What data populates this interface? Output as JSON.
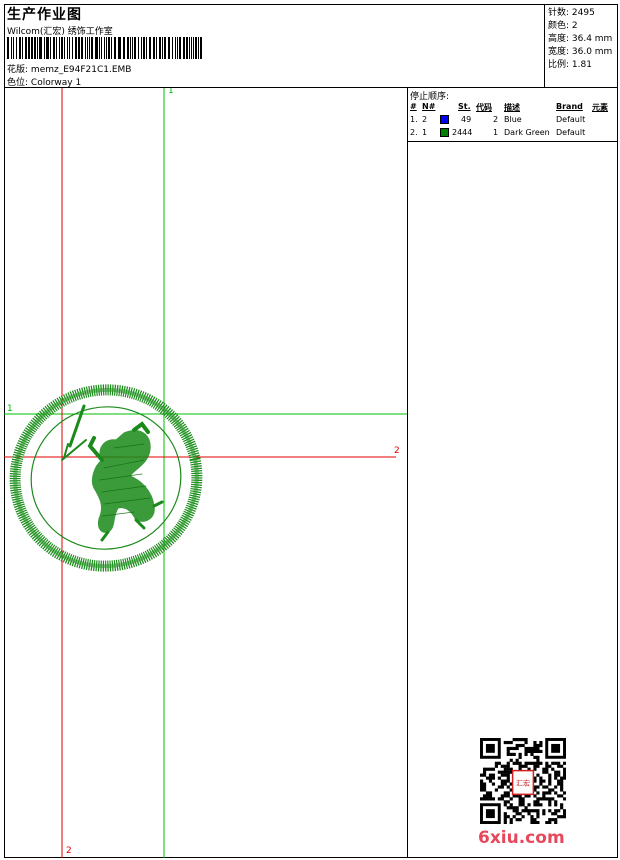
{
  "header": {
    "title": "生产作业图",
    "studio": "Wilcom(汇宏) 绣饰工作室",
    "design_label": "花版:",
    "design_value": "memz_E94F21C1.EMB",
    "colorway_label": "色位:",
    "colorway_value": "Colorway 1"
  },
  "stats": {
    "stitches": "针数: 2495",
    "colors": "颜色: 2",
    "height": "高度: 36.4 mm",
    "width": "宽度: 36.0 mm",
    "scale": "比例: 1.81"
  },
  "stop_sequence": {
    "title": "停止顺序:",
    "headers": {
      "hash": "#",
      "no": "N#",
      "st": "St.",
      "code": "代码",
      "desc": "描述",
      "brand": "Brand",
      "element": "元素"
    },
    "rows": [
      {
        "index": "1.",
        "n": "2",
        "color": "#0000ff",
        "stitches": "49",
        "code": "2",
        "desc": "Blue",
        "brand": "Default"
      },
      {
        "index": "2.",
        "n": "1",
        "color": "#008000",
        "stitches": "2444",
        "code": "1",
        "desc": "Dark Green",
        "brand": "Default"
      }
    ]
  },
  "canvas": {
    "labels": {
      "green_v_top": "1",
      "green_h_left": "1",
      "red_h_right": "2",
      "red_v_bottom": "2"
    },
    "colors": {
      "red_guide": "#e00000",
      "green_guide": "#00c000",
      "embroidery": "#1a8a1a"
    }
  },
  "footer": {
    "brand": "6xiu.com",
    "stamp_text": "汇宏"
  }
}
